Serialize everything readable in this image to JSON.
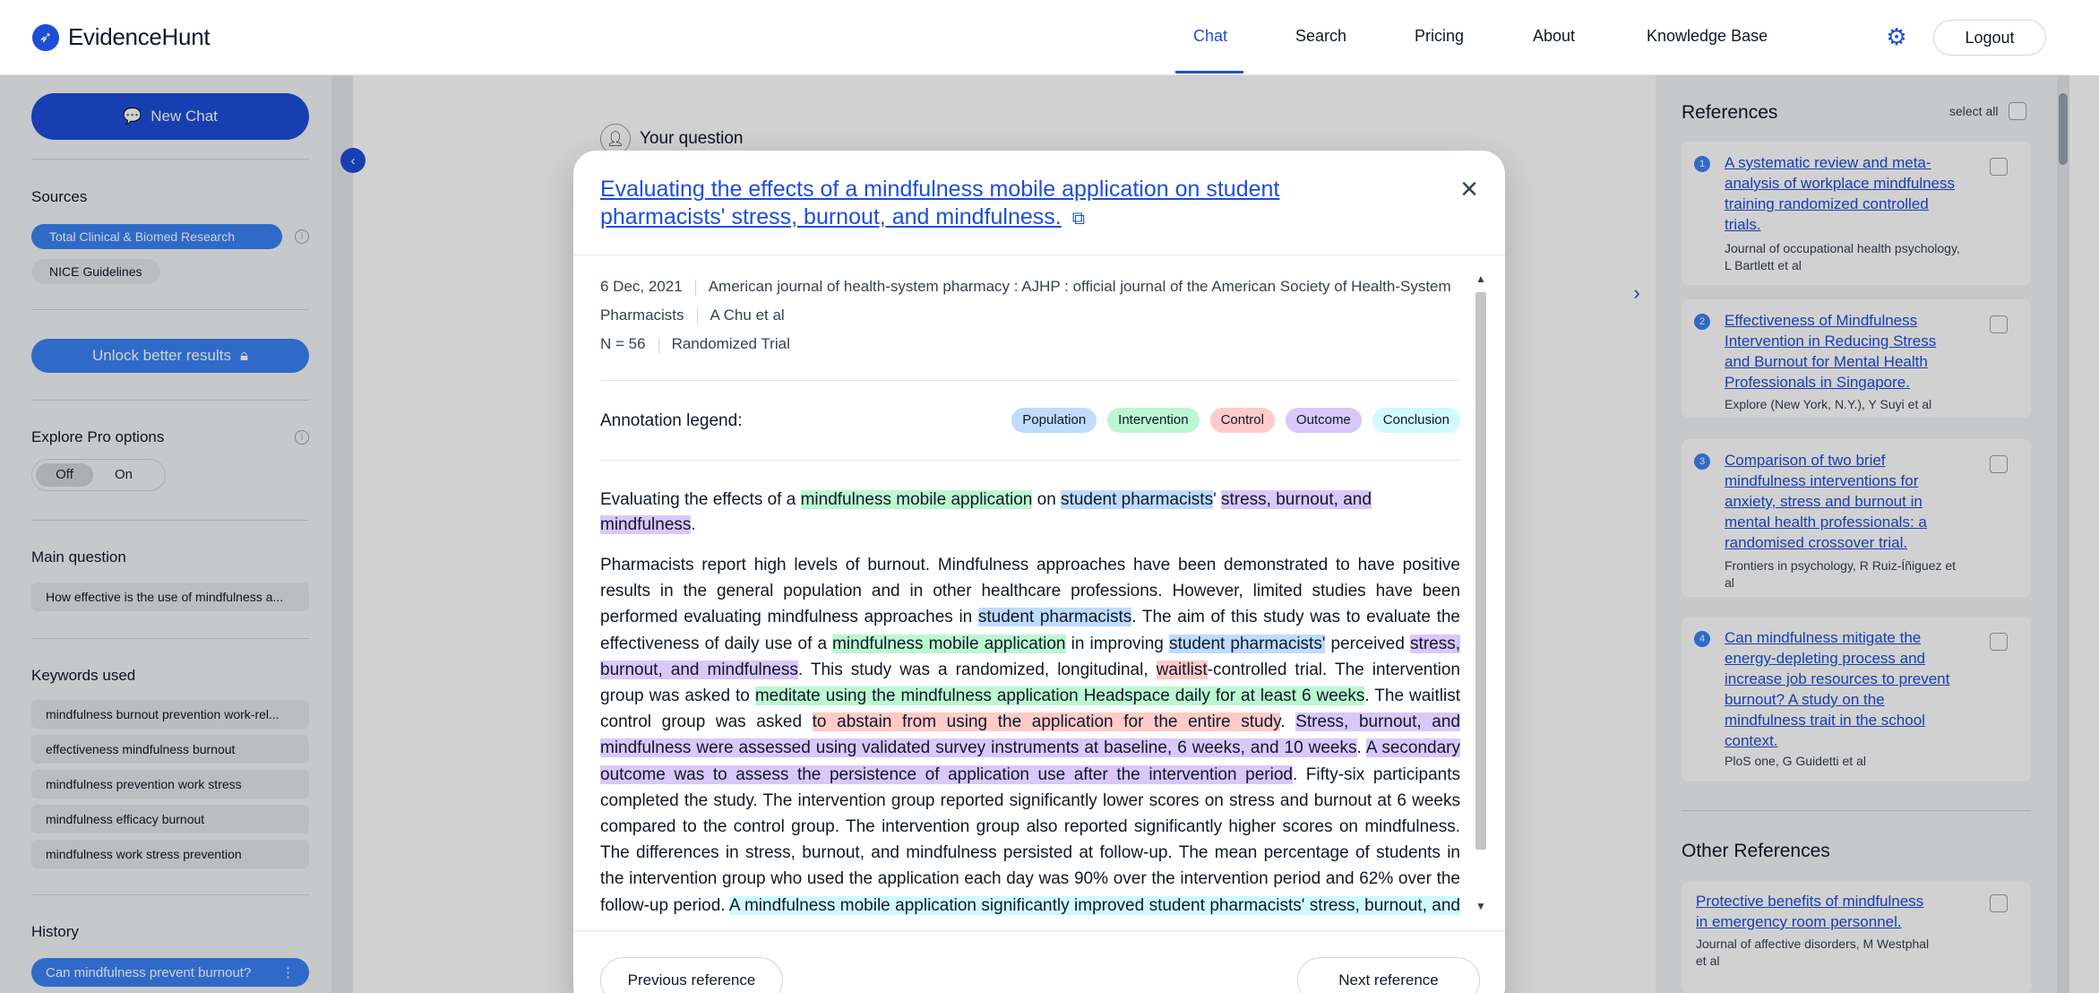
{
  "app": {
    "name": "EvidenceHunt"
  },
  "nav": {
    "items": [
      "Chat",
      "Search",
      "Pricing",
      "About",
      "Knowledge Base"
    ],
    "active": "Chat",
    "logout": "Logout"
  },
  "sidebar": {
    "new_chat": "New Chat",
    "sources_heading": "Sources",
    "sources": [
      "Total Clinical & Biomed Research",
      "NICE Guidelines"
    ],
    "unlock": "Unlock better results",
    "explore_heading": "Explore Pro options",
    "toggle_off": "Off",
    "toggle_on": "On",
    "main_question_heading": "Main question",
    "main_question": "How effective is the use of mindfulness a...",
    "keywords_heading": "Keywords used",
    "keywords": [
      "mindfulness burnout prevention work-rel...",
      "effectiveness mindfulness burnout",
      "mindfulness prevention work stress",
      "mindfulness efficacy burnout",
      "mindfulness work stress prevention"
    ],
    "history_heading": "History",
    "history_item": "Can mindfulness prevent burnout?"
  },
  "main": {
    "your_question": "Your question"
  },
  "references": {
    "title": "References",
    "select_all": "select all",
    "items": [
      {
        "num": "1",
        "title": "A systematic review and meta-analysis of workplace mindfulness training randomized controlled trials.",
        "meta": "Journal of occupational health psychology, L Bartlett et al"
      },
      {
        "num": "2",
        "title": "Effectiveness of Mindfulness Intervention in Reducing Stress and Burnout for Mental Health Professionals in Singapore.",
        "meta": "Explore (New York, N.Y.), Y Suyi et al"
      },
      {
        "num": "3",
        "title": "Comparison of two brief mindfulness interventions for anxiety, stress and burnout in mental health professionals: a randomised crossover trial.",
        "meta": "Frontiers in psychology, R Ruiz-Íñiguez et al"
      },
      {
        "num": "4",
        "title": "Can mindfulness mitigate the energy-depleting process and increase job resources to prevent burnout? A study on the mindfulness trait in the school context.",
        "meta": "PloS one, G Guidetti et al"
      }
    ],
    "other_title": "Other References",
    "other_items": [
      {
        "title": "Protective benefits of mindfulness in emergency room personnel.",
        "meta": "Journal of affective disorders, M Westphal et al"
      }
    ]
  },
  "modal": {
    "title": "Evaluating the effects of a mindfulness mobile application on student pharmacists' stress, burnout, and mindfulness.",
    "date": "6 Dec, 2021",
    "journal": "American journal of health-system pharmacy : AJHP : official journal of the American Society of Health-System Pharmacists",
    "authors": "A Chu et al",
    "n": "N = 56",
    "study_type": "Randomized Trial",
    "legend_label": "Annotation legend:",
    "legend": [
      "Population",
      "Intervention",
      "Control",
      "Outcome",
      "Conclusion"
    ],
    "prev": "Previous reference",
    "next": "Next reference"
  },
  "colors": {
    "accent": "#1d4ed8",
    "population": "#bfdbfe",
    "intervention": "#bbf7d0",
    "control": "#fecaca",
    "outcome": "#d8c8fb",
    "conclusion": "#cffafe"
  }
}
